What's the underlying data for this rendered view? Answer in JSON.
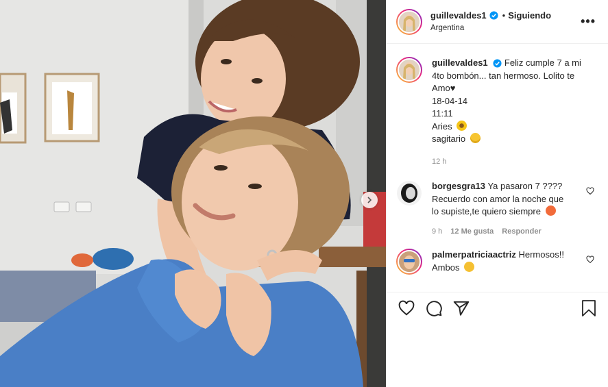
{
  "post": {
    "author": "guillevaldes1",
    "follow_separator": "•",
    "follow_status": "Siguiendo",
    "location": "Argentina",
    "more_label": "•••"
  },
  "caption": {
    "author": "guillevaldes1",
    "lines": [
      "Feliz cumple 7 a mi",
      "4to bombón... tan hermoso. Lolito te",
      "Amo♥",
      "18-04-14",
      "11:11",
      "Aries",
      "sagitario"
    ],
    "time": "12 h"
  },
  "comments": [
    {
      "user": "borgesgra13",
      "lines": [
        "Ya pasaron 7 ????",
        "Recuerdo con amor la noche que",
        "lo supiste,te quiero siempre"
      ],
      "time": "9 h",
      "likes": "12 Me gusta",
      "reply": "Responder"
    },
    {
      "user": "palmerpatriciaactriz",
      "lines": [
        "Hermosos!!",
        "Ambos"
      ]
    }
  ],
  "icons": [
    "more-icon",
    "verified-icon",
    "heart-icon",
    "comment-icon",
    "share-icon",
    "bookmark-icon",
    "chevron-right-icon"
  ],
  "colors": {
    "verified": "#0095f6",
    "meta_text": "#8e8e8e",
    "border": "#efefef",
    "sweater": "#4a7fc6"
  }
}
